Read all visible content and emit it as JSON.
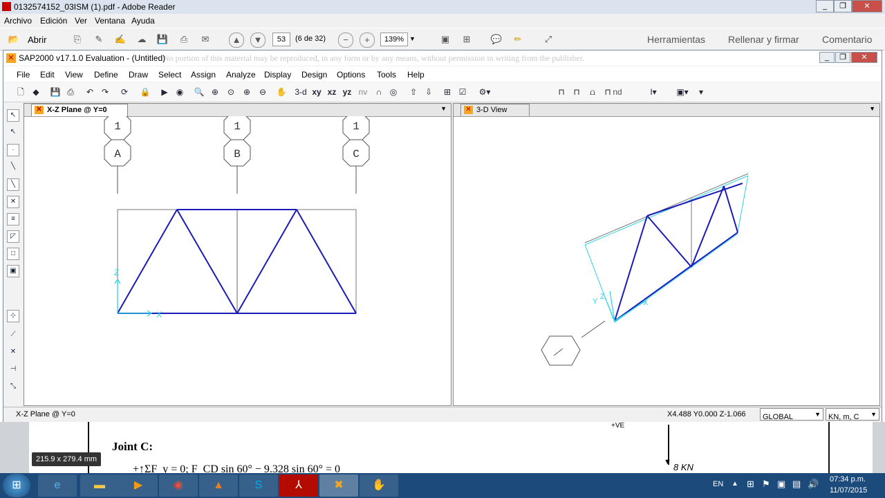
{
  "adobe": {
    "title": "0132574152_03ISM (1).pdf - Adobe Reader",
    "menu": [
      "Archivo",
      "Edición",
      "Ver",
      "Ventana",
      "Ayuda"
    ],
    "open_label": "Abrir",
    "page_num": "53",
    "page_of": "(6 de 32)",
    "zoom": "139%",
    "links": [
      "Herramientas",
      "Rellenar y firmar",
      "Comentario"
    ]
  },
  "sap": {
    "title": "SAP2000 v17.1.0 Evaluation  - (Untitled)",
    "watermark": ". No portion of this material may be reproduced, in any form or by any means, without permission in writing from the publisher.",
    "menu": [
      "File",
      "Edit",
      "View",
      "Define",
      "Draw",
      "Select",
      "Assign",
      "Analyze",
      "Display",
      "Design",
      "Options",
      "Tools",
      "Help"
    ],
    "view_buttons": [
      "3-d",
      "xy",
      "xz",
      "yz",
      "nv"
    ],
    "nd_label": "nd",
    "left_tab": "X-Z Plane @ Y=0",
    "right_tab": "3-D View",
    "grid_bubbles_top": [
      "1",
      "1",
      "1"
    ],
    "grid_bubbles": [
      "A",
      "B",
      "C"
    ],
    "axis_x": "X",
    "axis_z": "Z",
    "axis_y": "Y",
    "status_left": "X-Z Plane @ Y=0",
    "coords": "X4.488  Y0.000  Z-1.066",
    "coord_system": "GLOBAL",
    "units": "KN, m, C"
  },
  "pdf": {
    "joint": "Joint C:",
    "equation": "+↑ΣF_y = 0;   F_CD sin 60° − 9.328 sin 60° = 0",
    "page_size": "215.9 x 279.4 mm",
    "load_label": "8 KN",
    "ve_label": "+VE"
  },
  "taskbar": {
    "lang": "EN",
    "time": "07:34 p.m.",
    "date": "11/07/2015"
  },
  "colors": {
    "frame": "#1a1ab8",
    "grid_cyan": "#2ad4e8",
    "taskbar": "#1c4a7a"
  }
}
